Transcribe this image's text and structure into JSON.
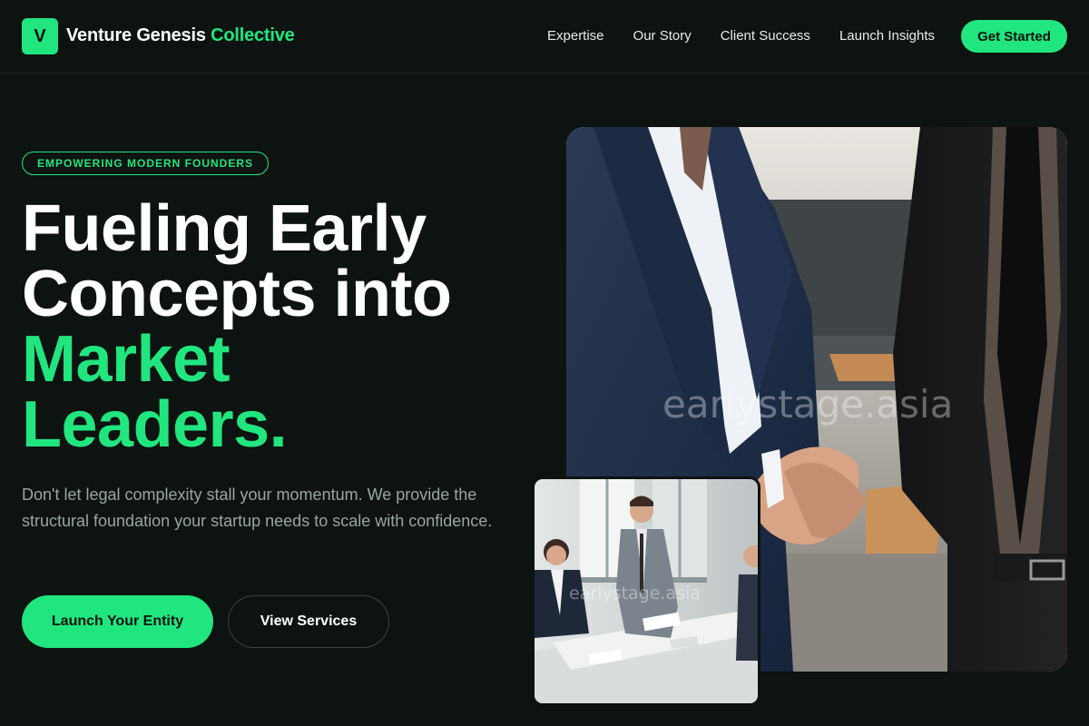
{
  "nav": {
    "logo_letter": "V",
    "brand_main": "Venture Genesis ",
    "brand_accent": "Collective",
    "links": [
      "Expertise",
      "Our Story",
      "Client Success",
      "Launch Insights"
    ],
    "cta_label": "Get Started"
  },
  "hero": {
    "badge": "EMPOWERING MODERN FOUNDERS",
    "headline_line1": "Fueling Early",
    "headline_line2": "Concepts into",
    "headline_line3": "Market",
    "headline_line4": "Leaders.",
    "subtext": "Don't let legal complexity stall your momentum. We provide the structural foundation your startup needs to scale with confidence.",
    "primary_button": "Launch Your Entity",
    "secondary_button": "View Services"
  },
  "images": {
    "main_watermark": "earlystage.asia",
    "small_watermark": "earlystage.asia"
  },
  "colors": {
    "accent": "#21e67f",
    "background": "#0c1311",
    "muted_text": "#9aa6a1"
  }
}
